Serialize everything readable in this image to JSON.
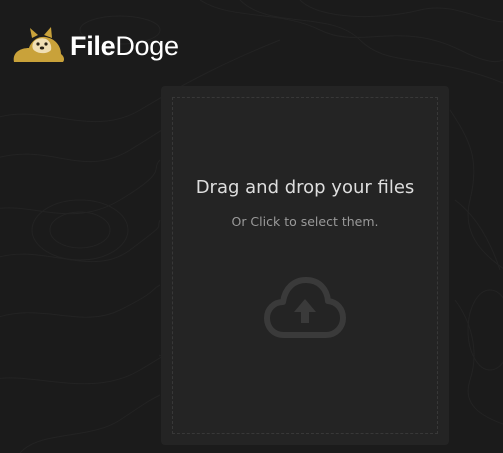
{
  "brand": {
    "name_bold": "File",
    "name_light": "Doge"
  },
  "dropzone": {
    "title": "Drag and drop your files",
    "subtitle": "Or Click to select them."
  },
  "icons": {
    "logo": "doge-cheems-icon",
    "upload": "cloud-upload-icon"
  },
  "colors": {
    "background": "#1b1b1b",
    "dropzone": "#242424",
    "logo_gold": "#c9a23a",
    "text_primary": "#dedede",
    "text_secondary": "#9a9a9a"
  }
}
